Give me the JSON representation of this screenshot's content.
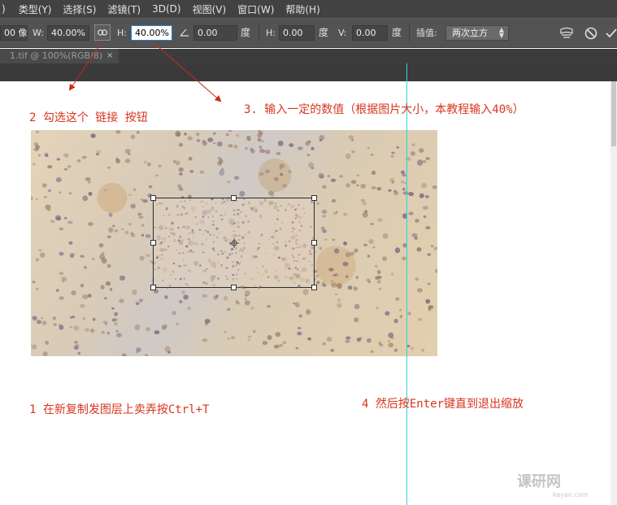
{
  "menu": [
    ")",
    "类型(Y)",
    "选择(S)",
    "滤镜(T)",
    "3D(D)",
    "视图(V)",
    "窗口(W)",
    "帮助(H)"
  ],
  "options": {
    "x_value": "00 像",
    "w_label": "W:",
    "w_value": "40.00%",
    "h_label": "H:",
    "h_value": "40.00%",
    "angle_value": "0.00",
    "deg1": "度",
    "hskew_label": "H:",
    "hskew_value": "0.00",
    "deg2": "度",
    "vskew_label": "V:",
    "vskew_value": "0.00",
    "deg3": "度",
    "interp_label": "插值:",
    "interp_value": "两次立方"
  },
  "tab": {
    "title": "1.tif @ 100%(RGB/8)",
    "close": "×"
  },
  "notes": {
    "step2": "2 勾选这个 链接 按钮",
    "step3": "3. 输入一定的数值（根据图片大小，本教程输入40%）",
    "step1": "1 在新复制发图层上卖弄按Ctrl+T",
    "step4": "4 然后按Enter键直到退出缩放"
  },
  "watermark": {
    "text": "课研网",
    "sub": "keyan.com"
  },
  "colors": {
    "annotation": "#d9341e",
    "guide": "#2fd3e0",
    "menubar": "#424242",
    "optbar": "#535353"
  },
  "icons": [
    "link-icon",
    "warp-icon",
    "cancel-icon",
    "commit-icon",
    "angle-icon"
  ]
}
